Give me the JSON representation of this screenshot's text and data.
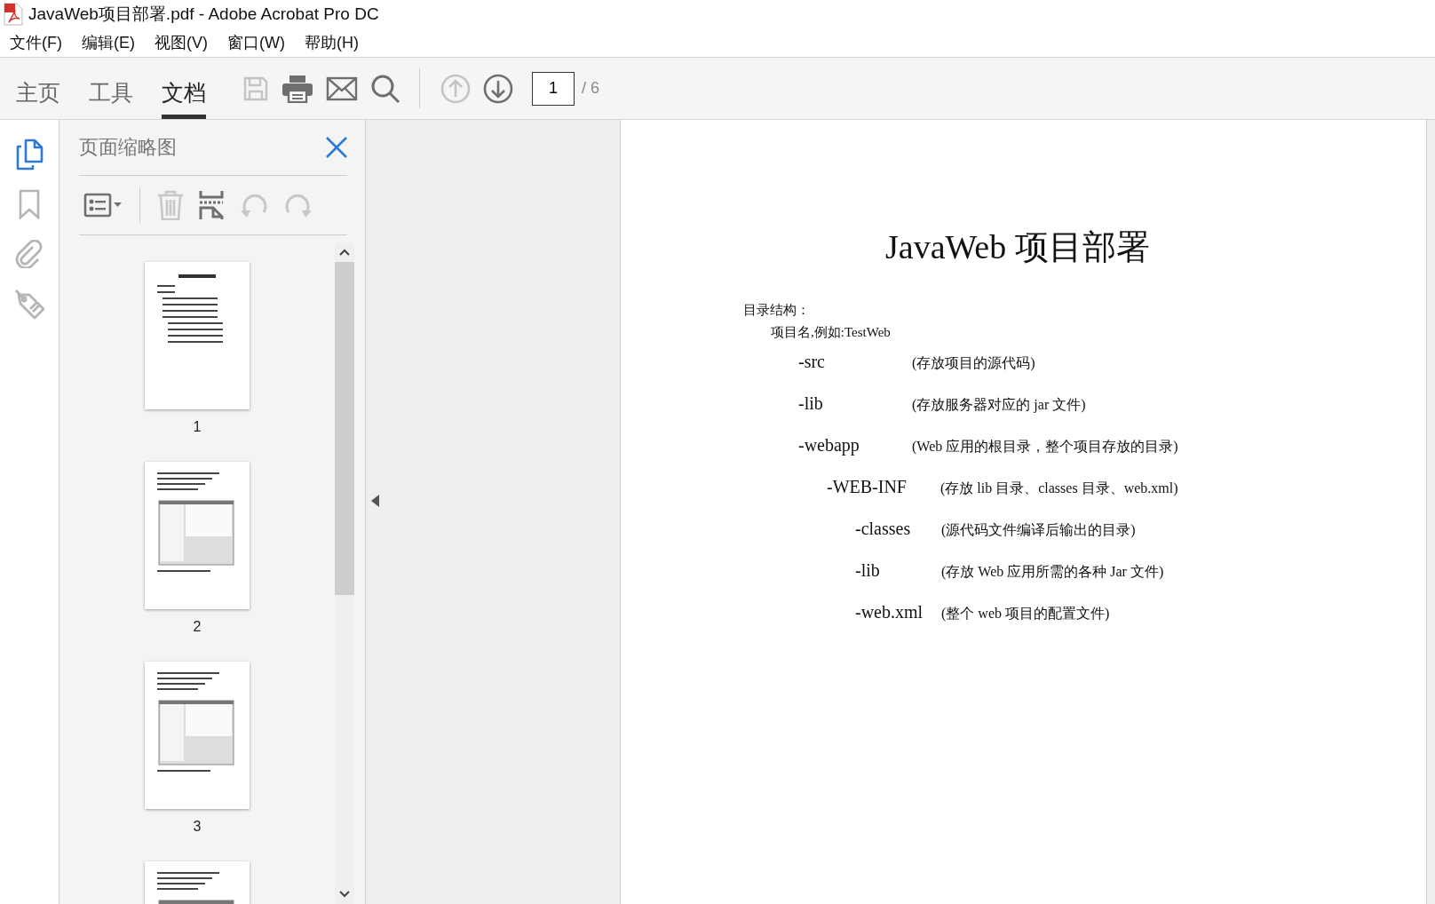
{
  "window": {
    "title": "JavaWeb项目部署.pdf - Adobe Acrobat Pro DC"
  },
  "menu": [
    {
      "label": "文件(F)"
    },
    {
      "label": "编辑(E)"
    },
    {
      "label": "视图(V)"
    },
    {
      "label": "窗口(W)"
    },
    {
      "label": "帮助(H)"
    }
  ],
  "tabs": [
    {
      "label": "主页",
      "selected": false
    },
    {
      "label": "工具",
      "selected": false
    },
    {
      "label": "文档",
      "selected": true
    }
  ],
  "toolbar": {
    "buttons": [
      {
        "kind": "save",
        "disabled": true
      },
      {
        "kind": "print",
        "disabled": false
      },
      {
        "kind": "mail",
        "disabled": false
      },
      {
        "kind": "search",
        "disabled": false
      },
      {
        "kind": "page-up",
        "disabled": true
      },
      {
        "kind": "page-down",
        "disabled": false
      }
    ],
    "page_field": {
      "value": "1"
    },
    "page_total": "/ 6"
  },
  "rail": [
    {
      "kind": "pages",
      "selected": true
    },
    {
      "kind": "bookmarks",
      "selected": false
    },
    {
      "kind": "attachments",
      "selected": false
    },
    {
      "kind": "tags",
      "selected": false
    }
  ],
  "thumbnails_panel": {
    "title": "页面缩略图",
    "tools": [
      {
        "kind": "options",
        "disabled": false
      },
      {
        "kind": "delete",
        "disabled": true
      },
      {
        "kind": "extract",
        "disabled": false
      },
      {
        "kind": "rotate-ccw",
        "disabled": true
      },
      {
        "kind": "rotate-cw",
        "disabled": true
      }
    ],
    "pages": [
      {
        "label": "1",
        "kind": "text"
      },
      {
        "label": "2",
        "kind": "screenshots"
      },
      {
        "label": "3",
        "kind": "screenshots"
      },
      {
        "kind": "screenshots"
      }
    ]
  },
  "document": {
    "title": "JavaWeb 项目部署",
    "heading": "目录结构：",
    "project": "项目名,例如:TestWeb",
    "entries": [
      {
        "name": "-src",
        "note": "(存放项目的源代码)"
      },
      {
        "name": "-lib",
        "note": "(存放服务器对应的 jar 文件)"
      },
      {
        "name": "-webapp",
        "note": "(Web 应用的根目录，整个项目存放的目录)",
        "children": [
          {
            "name": "-WEB-INF",
            "note": "(存放 lib 目录、classes 目录、web.xml)",
            "children": [
              {
                "name": "-classes",
                "note": "(源代码文件编译后输出的目录)"
              },
              {
                "name": "-lib",
                "note": "(存放 Web 应用所需的各种 Jar 文件)"
              },
              {
                "name": "-web.xml",
                "note": "(整个 web 项目的配置文件)"
              }
            ]
          }
        ]
      }
    ]
  }
}
